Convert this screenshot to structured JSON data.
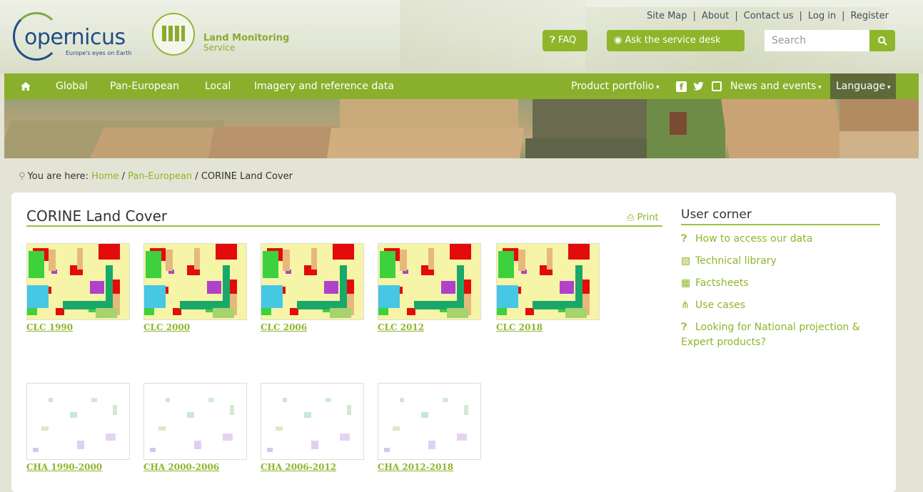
{
  "header": {
    "logo_main": "opernicus",
    "logo_tagline": "Europe's eyes on Earth",
    "logo_service_line1": "Land Monitoring",
    "logo_service_line2": "Service",
    "top_links": [
      "Site Map",
      "About",
      "Contact us",
      "Log in",
      "Register"
    ],
    "faq_label": "FAQ",
    "service_desk_label": "Ask the service desk",
    "search_placeholder": "Search"
  },
  "nav": {
    "items": [
      "Global",
      "Pan-European",
      "Local",
      "Imagery and reference data"
    ],
    "right_items": [
      "Product portfolio",
      "News and events",
      "Language"
    ]
  },
  "breadcrumb": {
    "prefix": "You are here:",
    "links": [
      "Home",
      "Pan-European"
    ],
    "current": "CORINE Land Cover"
  },
  "main": {
    "title": "CORINE Land Cover",
    "print_label": "Print",
    "products": [
      "CLC 1990",
      "CLC 2000",
      "CLC 2006",
      "CLC 2012",
      "CLC 2018"
    ],
    "changes": [
      "CHA 1990-2000",
      "CHA 2000-2006",
      "CHA 2006-2012",
      "CHA 2012-2018"
    ]
  },
  "user_corner": {
    "title": "User corner",
    "items": [
      {
        "label": "How to access our data",
        "icon": "question-circle-icon"
      },
      {
        "label": "Technical library",
        "icon": "book-icon"
      },
      {
        "label": "Factsheets",
        "icon": "factsheet-icon"
      },
      {
        "label": "Use cases",
        "icon": "use-cases-icon"
      },
      {
        "label": "Looking for National projection & Expert products?",
        "icon": "question-circle-icon"
      }
    ]
  },
  "colors": {
    "accent_green": "#8fb52a",
    "nav_green": "#8aaf2c",
    "language_bg": "#5f6a3a"
  }
}
